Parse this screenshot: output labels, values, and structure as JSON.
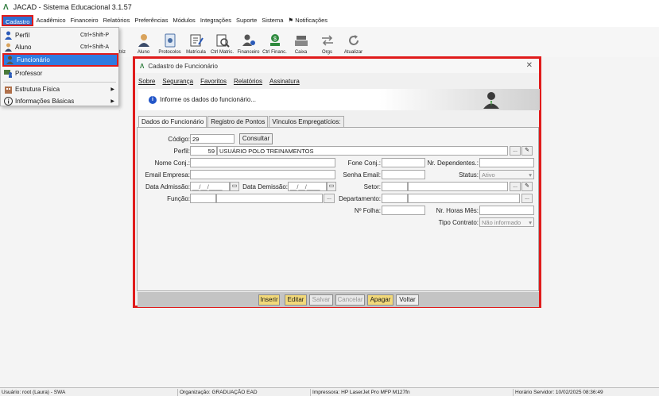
{
  "window": {
    "title": "JACAD - Sistema Educacional 3.1.57"
  },
  "menubar": [
    "Cadastro",
    "Acadêmico",
    "Financeiro",
    "Relatórios",
    "Preferências",
    "Módulos",
    "Integrações",
    "Suporte",
    "Sistema",
    "Notificações"
  ],
  "toolbar": [
    "triz",
    "Aluno",
    "Protocolos",
    "Matrícula",
    "Ctrl Matric.",
    "Financeiro",
    "Ctrl Financ.",
    "Caixa",
    "Orgs",
    "Atualizar"
  ],
  "cadastro_menu": {
    "items": [
      {
        "label": "Perfil",
        "shortcut": "Ctrl+Shift-P"
      },
      {
        "label": "Aluno",
        "shortcut": "Ctrl+Shift-A"
      },
      {
        "label": "Funcionário",
        "shortcut": ""
      },
      {
        "label": "Professor",
        "shortcut": ""
      },
      {
        "label": "Estrutura Física",
        "shortcut": ""
      },
      {
        "label": "Informações Básicas",
        "shortcut": ""
      }
    ]
  },
  "dialog": {
    "title": "Cadastro de Funcionário",
    "menu": [
      "Sobre",
      "Segurança",
      "Favoritos",
      "Relatórios",
      "Assinatura"
    ],
    "info": "Informe os dados do funcionário...",
    "tabs": [
      "Dados do Funcionário",
      "Registro de Pontos",
      "Vínculos Empregatícios:"
    ],
    "labels": {
      "codigo": "Código:",
      "perfil": "Perfil:",
      "nome_conj": "Nome Conj.:",
      "fone_conj": "Fone Conj.:",
      "nr_dependentes": "Nr. Dependentes.:",
      "email_empresa": "Email Empresa:",
      "senha_email": "Senha Email:",
      "status": "Status:",
      "data_admissao": "Data Admissão:",
      "data_demissao": "Data Demissão:",
      "setor": "Setor:",
      "funcao": "Função:",
      "departamento": "Departamento:",
      "n_folha": "Nº Folha:",
      "nr_horas_mes": "Nr. Horas Mês:",
      "tipo_contrato": "Tipo Contrato:"
    },
    "values": {
      "codigo": "29",
      "perfil_id": "59",
      "perfil_nome": "USUÁRIO POLO TREINAMENTOS",
      "status": "Ativo",
      "data_admissao": "__/__/____",
      "data_demissao": "__/__/____",
      "tipo_contrato": "Não informado"
    },
    "consultar": "Consultar",
    "dots": "...",
    "buttons": [
      "Inserir",
      "Editar",
      "Salvar",
      "Cancelar",
      "Apagar",
      "Voltar"
    ]
  },
  "statusbar": {
    "user": "Usuário: root (Laura) - SWA",
    "org": "Organização: GRADUAÇÃO EAD",
    "printer": "Impressora: HP LaserJet Pro MFP M127fn",
    "server_time": "Horário Servidor: 10/02/2025 08:36:49"
  },
  "colors": {
    "highlight_border": "#e01b1b",
    "selection": "#2f7be0",
    "action_button": "#f2d97a"
  }
}
